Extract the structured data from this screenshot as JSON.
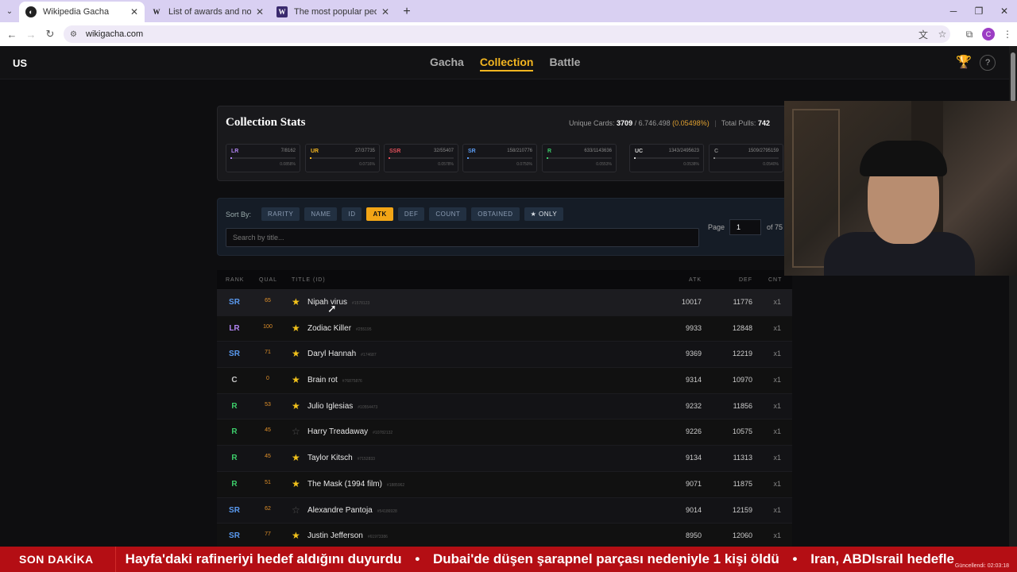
{
  "browser": {
    "tabs": [
      {
        "title": "Wikipedia Gacha",
        "active": true,
        "icon": "wikipedia-gacha-favicon"
      },
      {
        "title": "List of awards and nominations",
        "active": false,
        "icon": "wikipedia-favicon"
      },
      {
        "title": "The most popular people in Tu",
        "active": false,
        "icon": "w-favicon"
      }
    ],
    "url": "wikigacha.com",
    "profile_initial": "C"
  },
  "app": {
    "brand": "US",
    "nav": {
      "gacha": "Gacha",
      "collection": "Collection",
      "battle": "Battle"
    },
    "active_nav": "Collection",
    "help_label": "?"
  },
  "stats": {
    "title": "Collection Stats",
    "unique_label": "Unique Cards:",
    "unique_count": "3709",
    "unique_total": "/ 6.746.498",
    "unique_pct": "(0.05498%)",
    "pulls_label": "Total Pulls:",
    "pulls": "742",
    "rarities": [
      {
        "label": "LR",
        "count": "7/8162",
        "pct": "0.0858%",
        "color": "#b084f0",
        "fill": 0.09
      },
      {
        "label": "UR",
        "count": "27/37735",
        "pct": "0.0716%",
        "color": "#f2b520",
        "fill": 0.07
      },
      {
        "label": "SSR",
        "count": "32/55407",
        "pct": "0.0578%",
        "color": "#e0505a",
        "fill": 0.06
      },
      {
        "label": "SR",
        "count": "158/210776",
        "pct": "0.0750%",
        "color": "#5a9af0",
        "fill": 0.08
      },
      {
        "label": "R",
        "count": "633/1143636",
        "pct": "0.0553%",
        "color": "#3dcc6a",
        "fill": 0.06
      },
      {
        "label": "UC",
        "count": "1343/2495623",
        "pct": "0.0538%",
        "color": "#d0d0d0",
        "fill": 0.05
      },
      {
        "label": "C",
        "count": "1509/2795159",
        "pct": "0.0540%",
        "color": "#888888",
        "fill": 0.05
      }
    ]
  },
  "sort": {
    "label": "Sort By:",
    "options": [
      "RARITY",
      "NAME",
      "ID",
      "ATK",
      "DEF",
      "COUNT",
      "OBTAINED",
      "★ ONLY"
    ],
    "active": "ATK",
    "search_placeholder": "Search by title...",
    "page_label": "Page",
    "page_value": "1",
    "page_of": "of 75"
  },
  "table": {
    "headers": {
      "rank": "RANK",
      "qual": "QUAL",
      "title": "TITLE (ID)",
      "atk": "ATK",
      "def": "DEF",
      "cnt": "CNT"
    },
    "rows": [
      {
        "rank": "SR",
        "qual": "65",
        "fav": true,
        "title": "Nipah virus",
        "id": "#1578123",
        "atk": "10017",
        "def": "11776",
        "cnt": "x1"
      },
      {
        "rank": "LR",
        "qual": "100",
        "fav": true,
        "title": "Zodiac Killer",
        "id": "#255195",
        "atk": "9933",
        "def": "12848",
        "cnt": "x1"
      },
      {
        "rank": "SR",
        "qual": "71",
        "fav": true,
        "title": "Daryl Hannah",
        "id": "#174687",
        "atk": "9369",
        "def": "12219",
        "cnt": "x1"
      },
      {
        "rank": "C",
        "qual": "0",
        "fav": true,
        "title": "Brain rot",
        "id": "#76875876",
        "atk": "9314",
        "def": "10970",
        "cnt": "x1"
      },
      {
        "rank": "R",
        "qual": "53",
        "fav": true,
        "title": "Julio Iglesias",
        "id": "#10554473",
        "atk": "9232",
        "def": "11856",
        "cnt": "x1"
      },
      {
        "rank": "R",
        "qual": "45",
        "fav": false,
        "title": "Harry Treadaway",
        "id": "#10782132",
        "atk": "9226",
        "def": "10575",
        "cnt": "x1"
      },
      {
        "rank": "R",
        "qual": "45",
        "fav": true,
        "title": "Taylor Kitsch",
        "id": "#7152833",
        "atk": "9134",
        "def": "11313",
        "cnt": "x1"
      },
      {
        "rank": "R",
        "qual": "51",
        "fav": true,
        "title": "The Mask (1994 film)",
        "id": "#1885962",
        "atk": "9071",
        "def": "11875",
        "cnt": "x1"
      },
      {
        "rank": "SR",
        "qual": "62",
        "fav": false,
        "title": "Alexandre Pantoja",
        "id": "#54186928",
        "atk": "9014",
        "def": "12159",
        "cnt": "x1"
      },
      {
        "rank": "SR",
        "qual": "77",
        "fav": true,
        "title": "Justin Jefferson",
        "id": "#61973386",
        "atk": "8950",
        "def": "12060",
        "cnt": "x1"
      }
    ]
  },
  "rank_colors": {
    "LR": "#b084f0",
    "UR": "#f2b520",
    "SSR": "#e0505a",
    "SR": "#5a9af0",
    "R": "#3dcc6a",
    "UC": "#d0d0d0",
    "C": "#c8c8c8"
  },
  "ticker": {
    "label": "SON DAKİKA",
    "items": [
      "Hayfa'daki rafineriyi hedef aldığını duyurdu",
      "Dubai'de düşen şarapnel parçası nedeniyle 1 kişi öldü",
      "Iran, ABDIsrail hedefle"
    ],
    "updated": "Güncellendi: 02:03:18"
  }
}
